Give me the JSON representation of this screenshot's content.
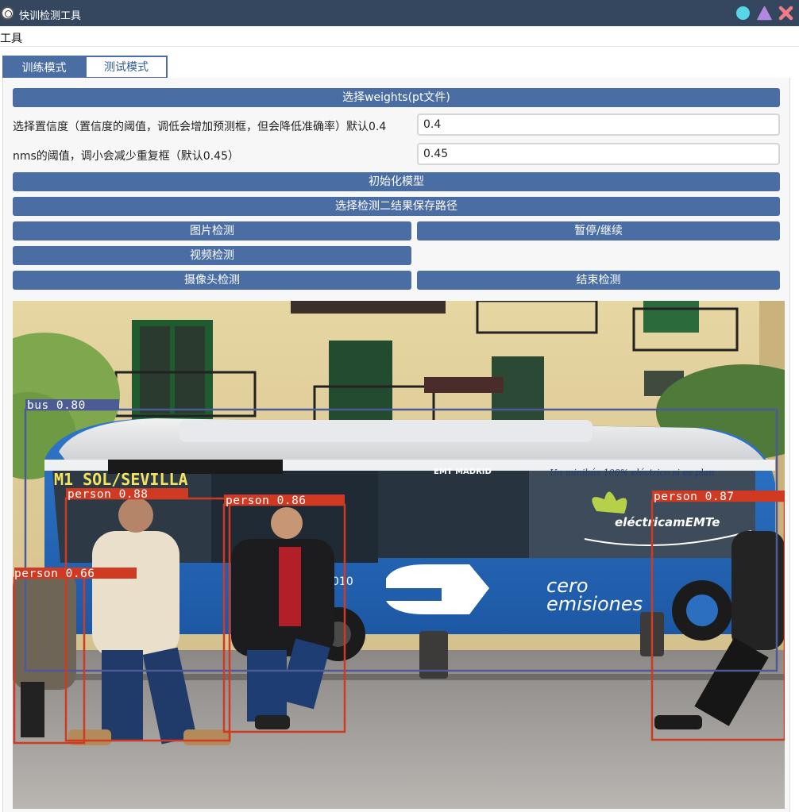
{
  "window": {
    "title": "快训检测工具"
  },
  "menu": {
    "tools": "工具"
  },
  "tabs": {
    "train": "训练模式",
    "test": "测试模式"
  },
  "controls": {
    "select_weights": "选择weights(pt文件)",
    "confidence_label": "选择置信度（置信度的阈值，调低会增加预测框，但会降低准确率）默认0.4",
    "confidence_value": "0.4",
    "nms_label": "nms的阈值，调小会减少重复框（默认0.45）",
    "nms_value": "0.45",
    "init_model": "初始化模型",
    "select_save_path": "选择检测二结果保存路径",
    "image_detect": "图片检测",
    "pause_resume": "暂停/继续",
    "video_detect": "视频检测",
    "camera_detect": "摄像头检测",
    "stop_detect": "结束检测"
  },
  "scene": {
    "bus_route_sign": "M1 SOL/SEVILLA",
    "bus_operator": "EMT MADRID",
    "bus_tagline": "Un minibús 100% eléctrico si es plan",
    "bus_brand": "eléctricamEMTe",
    "bus_slogan_1": "cero",
    "bus_slogan_2": "emisiones",
    "bus_fleet_number": "010"
  },
  "detections": [
    {
      "label": "bus",
      "confidence": "0.80",
      "color": "#4c5a96"
    },
    {
      "label": "person",
      "confidence": "0.88",
      "color": "#d03a22"
    },
    {
      "label": "person",
      "confidence": "0.86",
      "color": "#d03a22"
    },
    {
      "label": "person",
      "confidence": "0.66",
      "color": "#d03a22"
    },
    {
      "label": "person",
      "confidence": "0.87",
      "color": "#d03a22"
    }
  ],
  "colors": {
    "titlebar": "#34475f",
    "accent": "#4a6ea3",
    "min_button": "#57d6e8",
    "max_button": "#b487e0",
    "close_button": "#f07d86"
  }
}
